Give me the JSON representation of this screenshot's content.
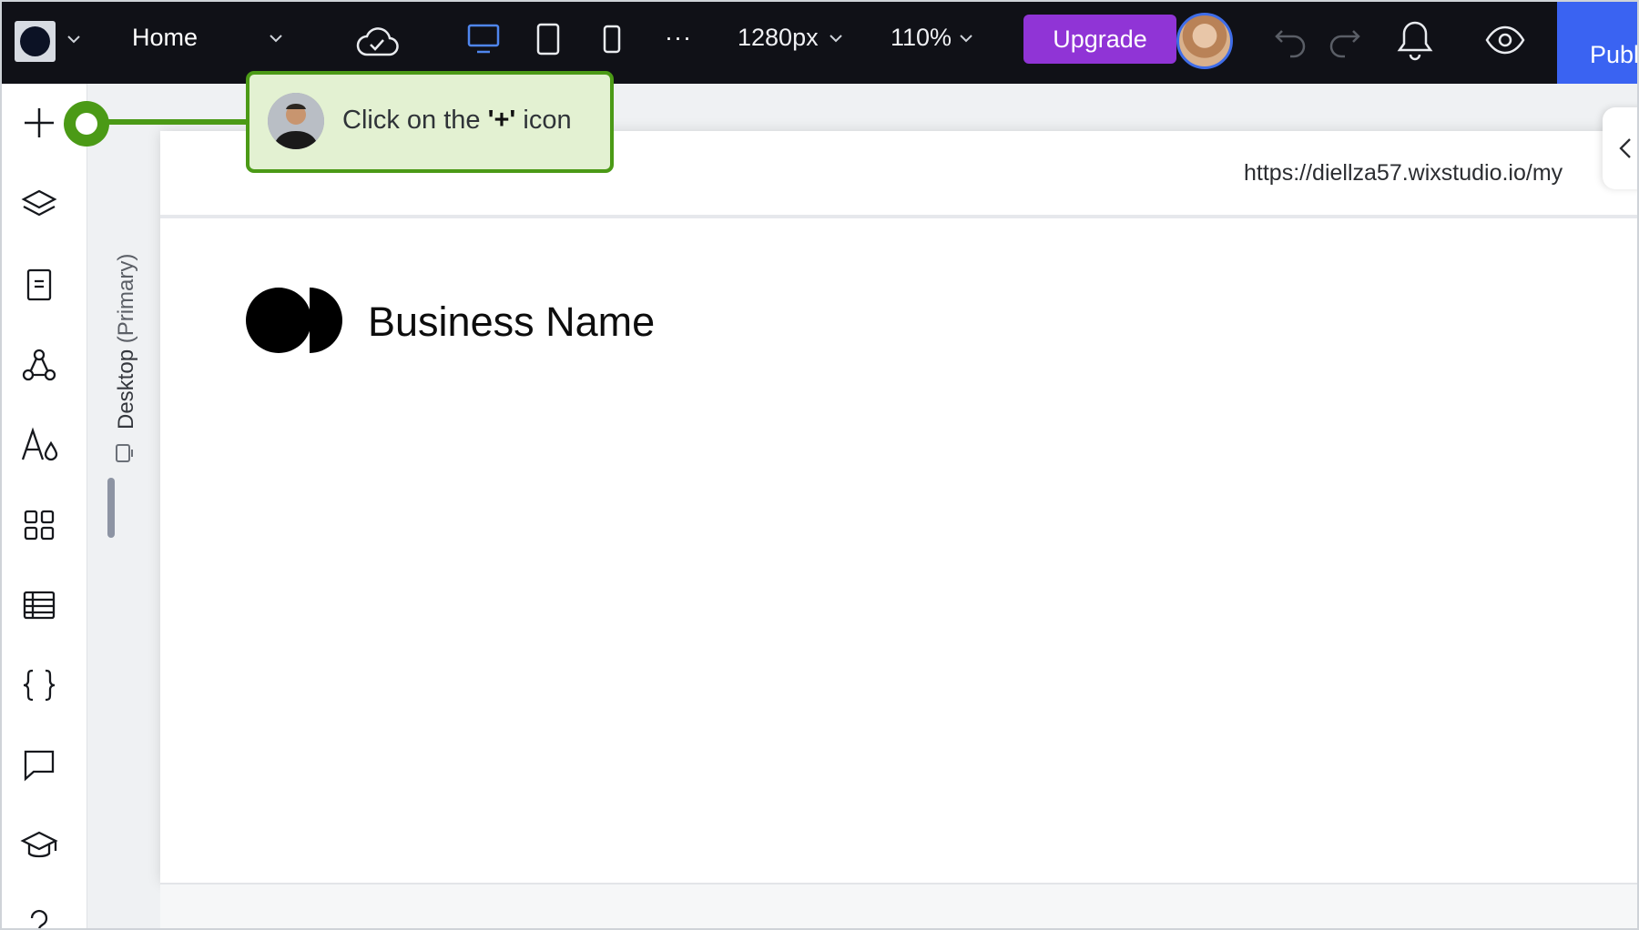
{
  "topbar": {
    "page_name": "Home",
    "width_value": "1280px",
    "zoom_value": "110%",
    "upgrade_label": "Upgrade",
    "publish_label": "Publ"
  },
  "left_toolbar": {
    "items": [
      "add-icon",
      "layers-icon",
      "pages-icon",
      "connections-icon",
      "theme-icon",
      "apps-icon",
      "cms-icon",
      "code-icon",
      "comments-icon",
      "learn-icon",
      "help-icon"
    ]
  },
  "breakpoint": {
    "name": "Desktop",
    "qualifier": "(Primary)"
  },
  "canvas": {
    "url": "https://diellza57.wixstudio.io/my",
    "business_name": "Business Name"
  },
  "tutorial": {
    "text_before": "Click on the ",
    "text_bold": "'+'",
    "text_after": " icon"
  },
  "colors": {
    "topbar": "#101117",
    "upgrade": "#9034d6",
    "publish": "#3a63f2",
    "callout_border": "#4b9a16",
    "callout_bg": "#e3f1d2",
    "active_device": "#4f86ee"
  }
}
